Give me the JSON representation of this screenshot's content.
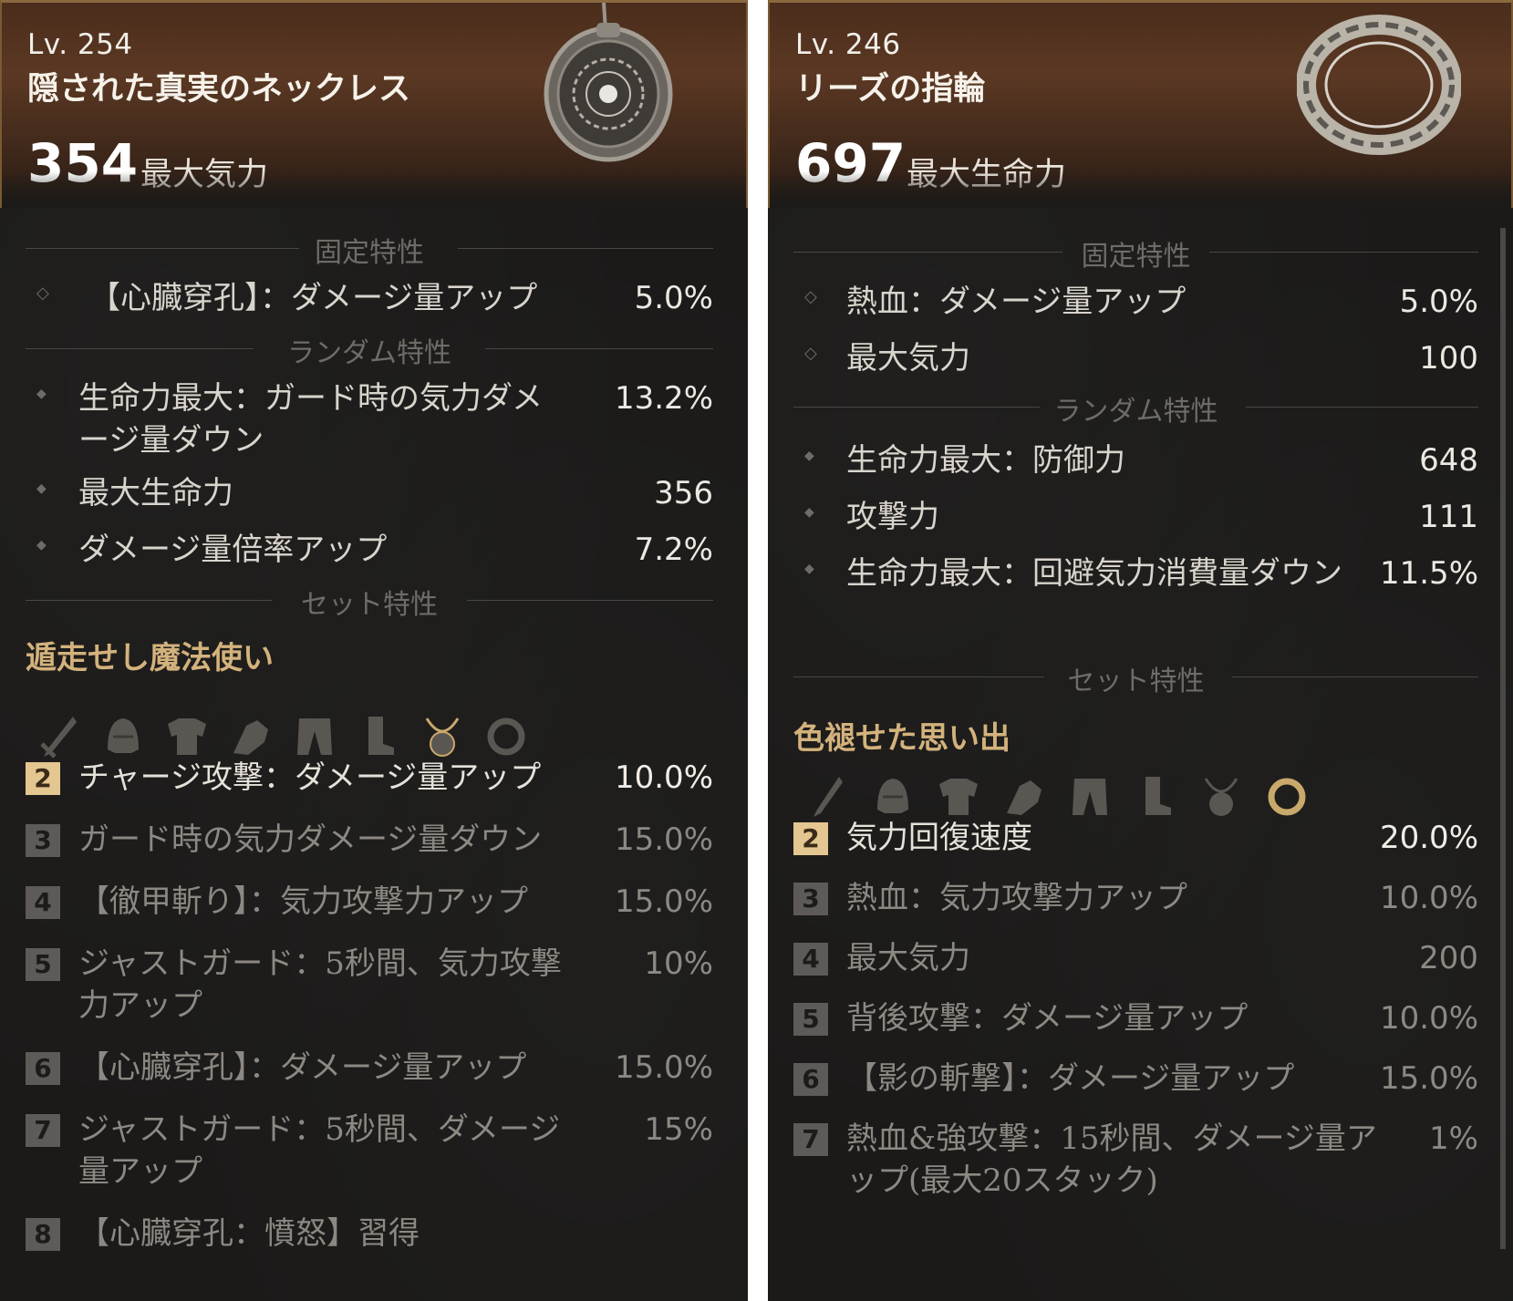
{
  "left": {
    "level": "Lv. 254",
    "item_name": "隠された真実のネックレス",
    "main_stat": {
      "value": "354",
      "label": "最大気力"
    },
    "item_icon": "necklace-icon",
    "fixed": {
      "title": "固定特性",
      "stats": [
        {
          "name": "【心臓穿孔】：ダメージ量アップ",
          "value": "5.0%"
        }
      ]
    },
    "random": {
      "title": "ランダム特性",
      "stats": [
        {
          "name": "生命力最大：ガード時の気力ダメージ量ダウン",
          "value": "13.2%"
        },
        {
          "name": "最大生命力",
          "value": "356"
        },
        {
          "name": "ダメージ量倍率アップ",
          "value": "7.2%"
        }
      ]
    },
    "set": {
      "title": "セット特性",
      "name": "遁走せし魔法使い",
      "icons": [
        "sword-icon",
        "helmet-icon",
        "armor-icon",
        "gauntlet-icon",
        "pants-icon",
        "boots-icon",
        "necklace-icon",
        "ring-icon"
      ],
      "bonuses": [
        {
          "count": "2",
          "name": "チャージ攻撃：ダメージ量アップ",
          "value": "10.0%"
        },
        {
          "count": "3",
          "name": "ガード時の気力ダメージ量ダウン",
          "value": "15.0%"
        },
        {
          "count": "4",
          "name": "【徹甲斬り】：気力攻撃力アップ",
          "value": "15.0%"
        },
        {
          "count": "5",
          "name": "ジャストガード：5秒間、気力攻撃力アップ",
          "value": "10%"
        },
        {
          "count": "6",
          "name": "【心臓穿孔】：ダメージ量アップ",
          "value": "15.0%"
        },
        {
          "count": "7",
          "name": "ジャストガード：5秒間、ダメージ量アップ",
          "value": "15%"
        },
        {
          "count": "8",
          "name": "【心臓穿孔：憤怒】習得",
          "value": ""
        }
      ]
    }
  },
  "right": {
    "level": "Lv. 246",
    "item_name": "リーズの指輪",
    "main_stat": {
      "value": "697",
      "label": "最大生命力"
    },
    "item_icon": "ring-icon",
    "fixed": {
      "title": "固定特性",
      "stats": [
        {
          "name": "熱血：ダメージ量アップ",
          "value": "5.0%"
        },
        {
          "name": "最大気力",
          "value": "100"
        }
      ]
    },
    "random": {
      "title": "ランダム特性",
      "stats": [
        {
          "name": "生命力最大：防御力",
          "value": "648"
        },
        {
          "name": "攻撃力",
          "value": "111"
        },
        {
          "name": "生命力最大：回避気力消費量ダウン",
          "value": "11.5%"
        }
      ]
    },
    "set": {
      "title": "セット特性",
      "name": "色褪せた思い出",
      "icons": [
        "sword-icon",
        "helmet-icon",
        "armor-icon",
        "gauntlet-icon",
        "pants-icon",
        "boots-icon",
        "necklace-icon",
        "ring-icon"
      ],
      "bonuses": [
        {
          "count": "2",
          "name": "気力回復速度",
          "value": "20.0%"
        },
        {
          "count": "3",
          "name": "熱血：気力攻撃力アップ",
          "value": "10.0%"
        },
        {
          "count": "4",
          "name": "最大気力",
          "value": "200"
        },
        {
          "count": "5",
          "name": "背後攻撃：ダメージ量アップ",
          "value": "10.0%"
        },
        {
          "count": "6",
          "name": "【影の斬撃】：ダメージ量アップ",
          "value": "15.0%"
        },
        {
          "count": "7",
          "name": "熱血&強攻撃：15秒間、ダメージ量アップ(最大20スタック)",
          "value": "1%"
        }
      ]
    }
  },
  "colors": {
    "accent_gold": "#e4c690",
    "set_name": "#d3b27c",
    "inactive_text": "#8d8882",
    "header_brown": "#5b3823"
  }
}
